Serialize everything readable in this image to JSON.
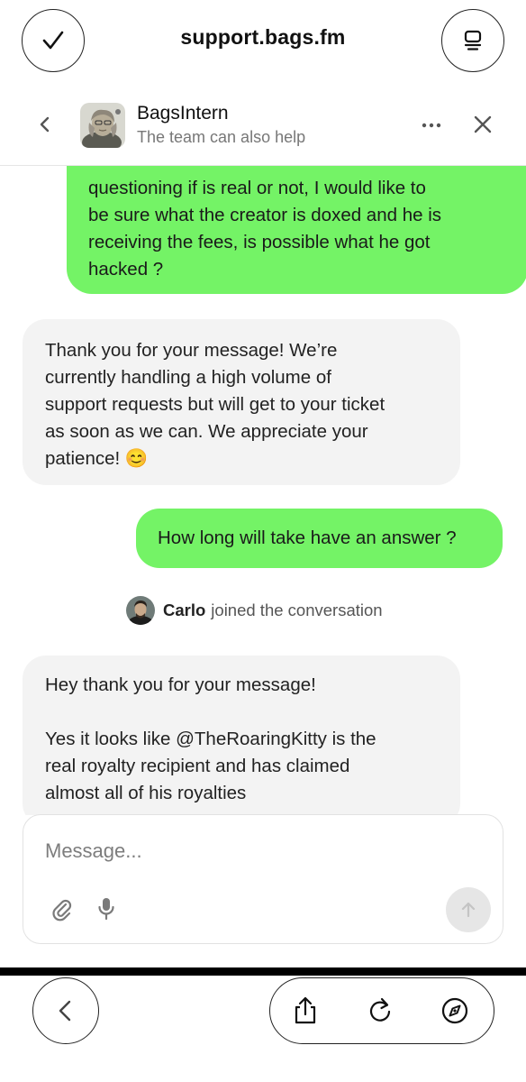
{
  "browser": {
    "url": "support.bags.fm",
    "icons": {
      "done": "checkmark-icon",
      "tabs": "tabs-icon",
      "back": "chevron-left-icon",
      "share": "share-icon",
      "reload": "reload-icon",
      "compass": "compass-icon"
    }
  },
  "chat_header": {
    "name": "BagsIntern",
    "subtitle": "The team can also help",
    "icons": {
      "back": "chevron-left-icon",
      "more": "ellipsis-icon",
      "close": "close-icon"
    }
  },
  "messages": [
    {
      "sender": "user",
      "lines": [
        "questioning if is real or not, I would like to",
        "be sure what the creator is doxed and he is",
        "receiving the fees, is possible what he got",
        "hacked ?"
      ]
    },
    {
      "sender": "bot",
      "lines": [
        "Thank you for your message! We’re",
        "currently handling a high volume of",
        "support requests but will get to your ticket",
        "as soon as we can. We appreciate your"
      ],
      "last_line": "patience!",
      "emoji": "😊"
    },
    {
      "sender": "user",
      "text": "How long will take have an answer ?"
    },
    {
      "sender": "agent",
      "lines": [
        "Hey thank you for your message!",
        "",
        "Yes it looks like @TheRoaringKitty is the",
        "real royalty recipient and has claimed",
        "almost all of his royalties"
      ]
    }
  ],
  "event": {
    "name": "Carlo",
    "text": "joined the conversation"
  },
  "composer": {
    "placeholder": "Message...",
    "icons": {
      "attach": "paperclip-icon",
      "mic": "microphone-icon",
      "send": "arrow-up-icon"
    }
  },
  "colors": {
    "user_bubble": "#74f366",
    "bot_bubble": "#f3f3f3",
    "send_disabled": "#e6e6e6"
  }
}
